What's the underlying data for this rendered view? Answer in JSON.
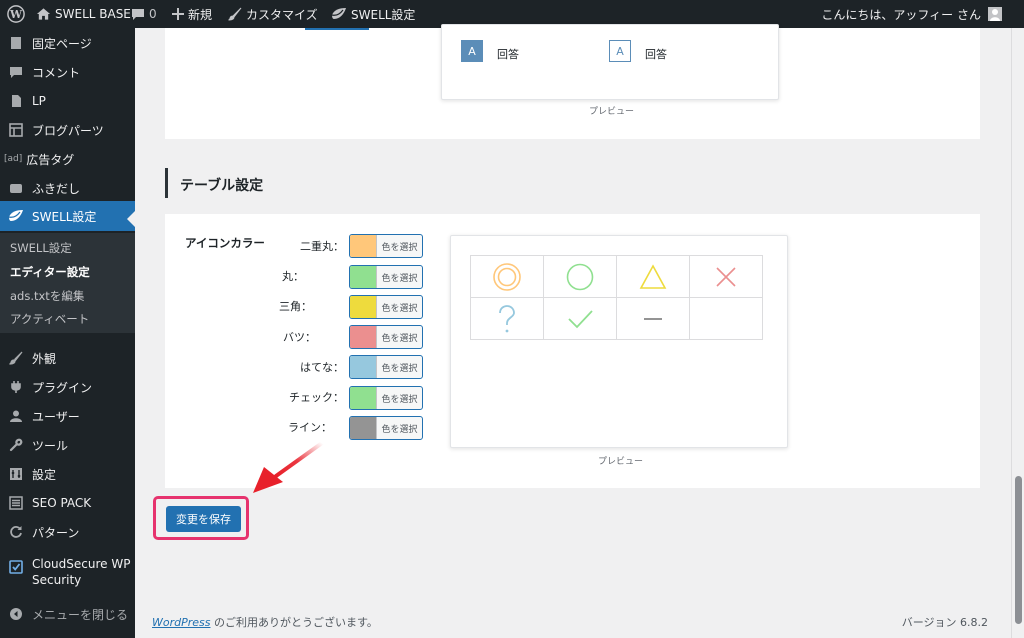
{
  "adminbar": {
    "site_name": "SWELL BASE",
    "comments_count": "0",
    "new_label": "新規",
    "customize_label": "カスタマイズ",
    "swell_settings_label": "SWELL設定",
    "greeting": "こんにちは、アッフィー さん"
  },
  "sidebar": {
    "items": [
      {
        "label": "固定ページ",
        "icon": "page-icon"
      },
      {
        "label": "コメント",
        "icon": "comment-icon"
      },
      {
        "label": "LP",
        "icon": "document-icon"
      },
      {
        "label": "ブログパーツ",
        "icon": "grid-icon"
      },
      {
        "label": "広告タグ",
        "icon": "ad-icon",
        "icon_text": "[ad]"
      },
      {
        "label": "ふきだし",
        "icon": "balloon-icon"
      },
      {
        "label": "SWELL設定",
        "icon": "swell-icon",
        "current": true
      },
      {
        "label": "外観",
        "icon": "brush-icon"
      },
      {
        "label": "プラグイン",
        "icon": "plugin-icon"
      },
      {
        "label": "ユーザー",
        "icon": "user-icon"
      },
      {
        "label": "ツール",
        "icon": "wrench-icon"
      },
      {
        "label": "設定",
        "icon": "settings-icon"
      },
      {
        "label": "SEO PACK",
        "icon": "list-icon"
      },
      {
        "label": "パターン",
        "icon": "refresh-icon"
      },
      {
        "label": "CloudSecure WP Security",
        "icon": "shield-check-icon"
      },
      {
        "label": "メニューを閉じる",
        "icon": "collapse-icon"
      }
    ],
    "submenu": [
      {
        "label": "SWELL設定"
      },
      {
        "label": "エディター設定",
        "active": true
      },
      {
        "label": "ads.txtを編集"
      },
      {
        "label": "アクティベート"
      }
    ]
  },
  "top_preview": {
    "answer_label_1": "回答",
    "answer_label_2": "回答",
    "badge_letter": "A",
    "caption": "プレビュー"
  },
  "table_section": {
    "title": "テーブル設定",
    "field_label": "アイコンカラー",
    "select_label": "色を選択",
    "colors": [
      {
        "label": "二重丸：",
        "color": "#ffc77a"
      },
      {
        "label": "丸：",
        "color": "#90e090"
      },
      {
        "label": "三角：",
        "color": "#eedb3d"
      },
      {
        "label": "バツ：",
        "color": "#eb8f8f"
      },
      {
        "label": "はてな：",
        "color": "#96c8de"
      },
      {
        "label": "チェック：",
        "color": "#90e090"
      },
      {
        "label": "ライン：",
        "color": "#949494"
      }
    ],
    "preview_caption": "プレビュー",
    "preview_icons": [
      [
        "double-circle-icon",
        "circle-icon",
        "triangle-icon",
        "cross-icon"
      ],
      [
        "question-icon",
        "check-icon",
        "line-icon",
        ""
      ]
    ]
  },
  "save_button": "変更を保存",
  "footer": {
    "wp_link": "WordPress",
    "thanks": "のご利用ありがとうございます。",
    "version": "バージョン 6.8.2"
  },
  "colors": {
    "accent": "#2271b1",
    "adminbar_bg": "#1d2327",
    "highlight": "#e6336e",
    "arrow": "#e8212b"
  }
}
